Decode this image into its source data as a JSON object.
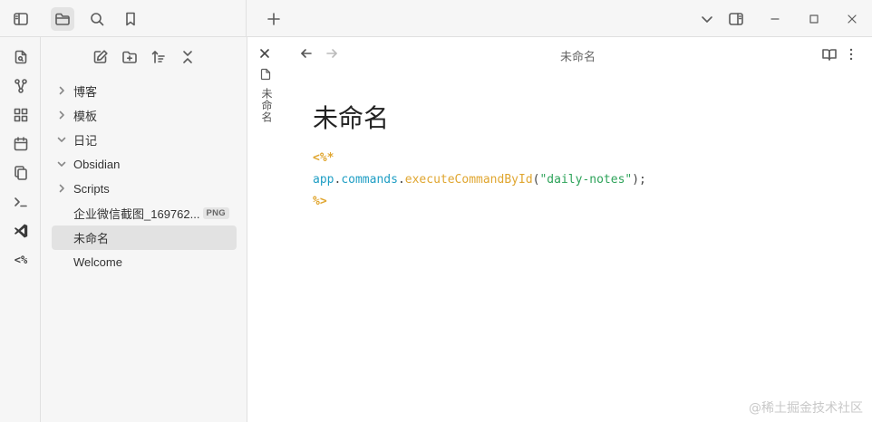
{
  "topbar": {
    "new_tab_icon": "plus-icon",
    "window_controls": [
      "minimize",
      "maximize",
      "close"
    ]
  },
  "ribbon": {
    "items": [
      "switcher-icon",
      "graph-icon",
      "canvas-icon",
      "daily-note-icon",
      "templates-icon",
      "command-palette-icon",
      "vscode-icon",
      "templater-icon"
    ],
    "templater_label": "<%"
  },
  "sidebar": {
    "items": [
      {
        "label": "博客",
        "type": "folder"
      },
      {
        "label": "模板",
        "type": "folder"
      },
      {
        "label": "日记",
        "type": "folder-open"
      },
      {
        "label": "Obsidian",
        "type": "folder-open"
      },
      {
        "label": "Scripts",
        "type": "folder"
      },
      {
        "label": "企业微信截图_169762...",
        "type": "file",
        "badge": "PNG"
      },
      {
        "label": "未命名",
        "type": "file",
        "active": true
      },
      {
        "label": "Welcome",
        "type": "file"
      }
    ]
  },
  "editor": {
    "tab_title": "未命名",
    "header_title": "未命名",
    "doc_title": "未命名",
    "code": {
      "open_tag": "<%*",
      "obj": "app",
      "dot1": ".",
      "prop": "commands",
      "dot2": ".",
      "method": "executeCommandById",
      "lparen": "(",
      "arg": "\"daily-notes\"",
      "rparen": ");",
      "close_tag": "%>"
    }
  },
  "watermark": "@稀土掘金技术社区"
}
